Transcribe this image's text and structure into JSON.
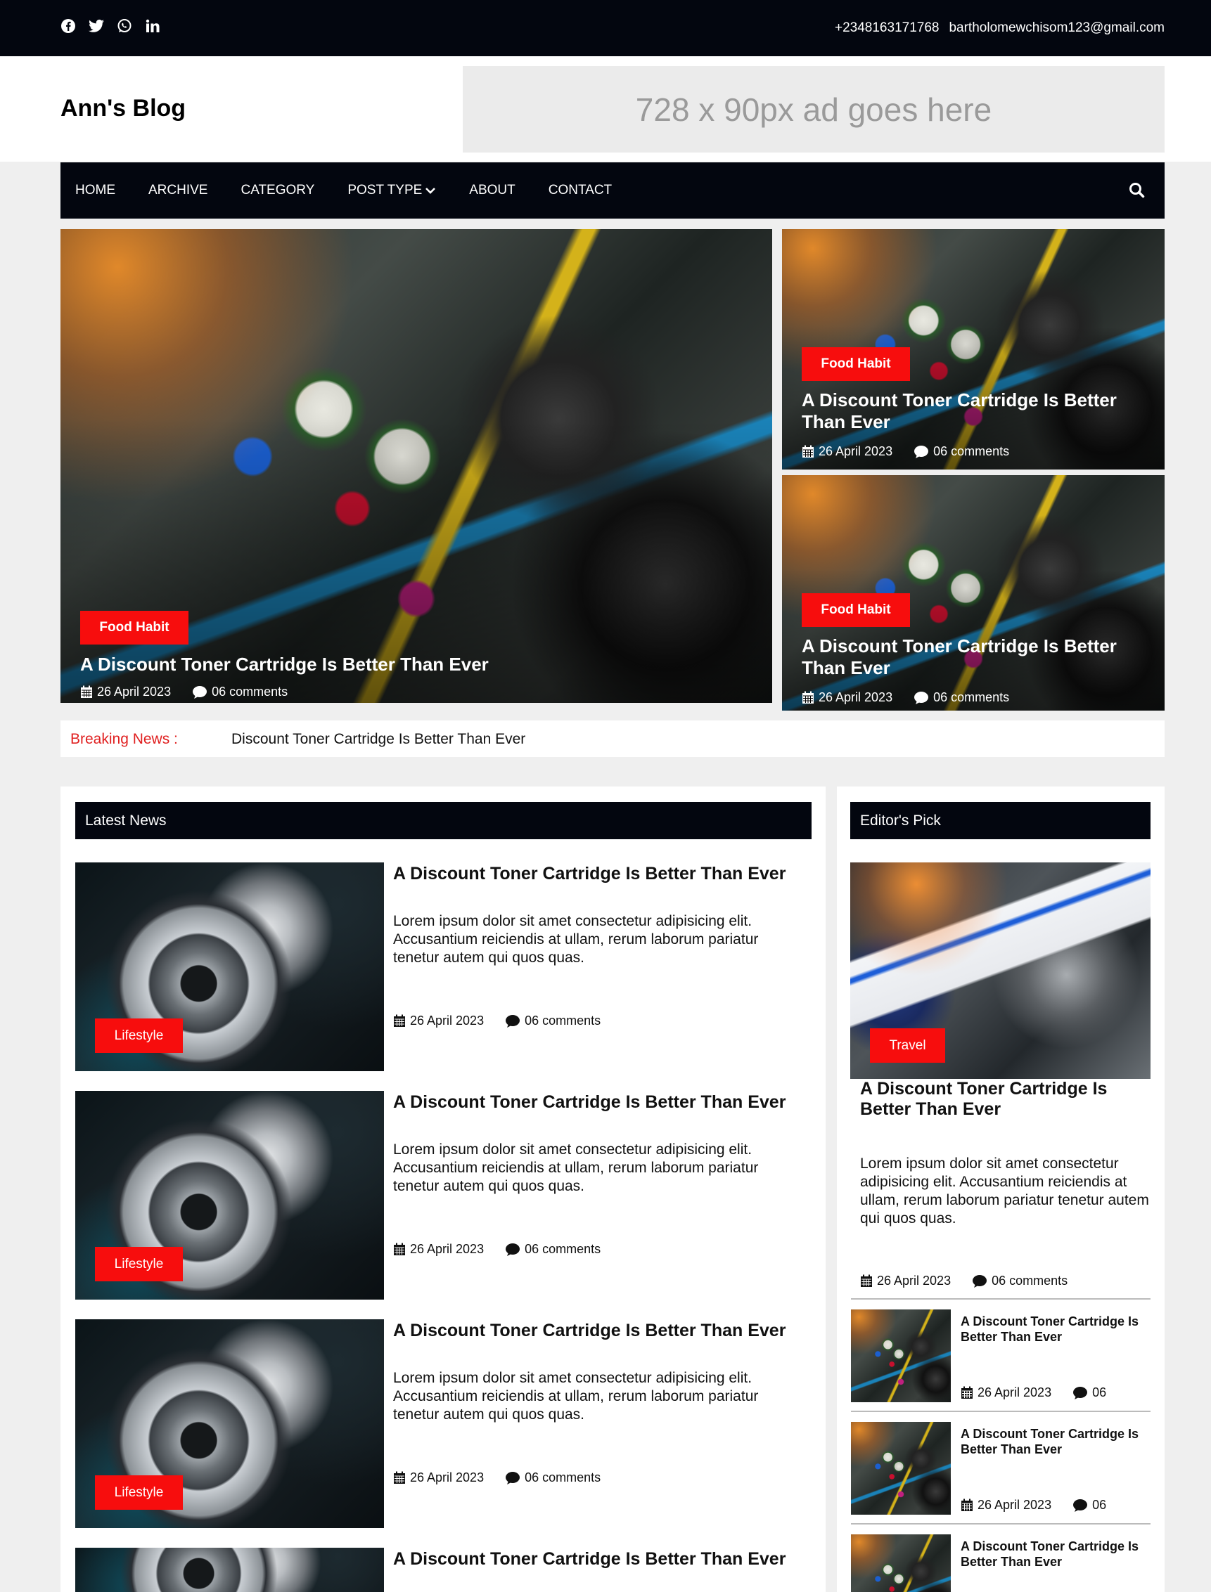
{
  "topbar": {
    "social_icons": [
      "facebook-icon",
      "twitter-icon",
      "whatsapp-icon",
      "linkedin-icon"
    ],
    "phone": "+2348163171768",
    "email": "bartholomewchisom123@gmail.com"
  },
  "header": {
    "logo": "Ann's Blog",
    "ad_text": "728 x 90px ad goes here"
  },
  "nav": {
    "items": [
      "HOME",
      "ARCHIVE",
      "CATEGORY",
      "POST TYPE",
      "ABOUT",
      "CONTACT"
    ],
    "search_icon": "search-icon"
  },
  "hero": {
    "main": {
      "tag": "Food Habit",
      "title": "A Discount Toner Cartridge Is Better Than Ever",
      "date": "26 April 2023",
      "comments": "06 comments"
    },
    "side": [
      {
        "tag": "Food Habit",
        "title": "A Discount Toner Cartridge Is Better Than Ever",
        "date": "26 April 2023",
        "comments": "06 comments"
      },
      {
        "tag": "Food Habit",
        "title": "A Discount Toner Cartridge Is Better Than Ever",
        "date": "26 April 2023",
        "comments": "06 comments"
      }
    ]
  },
  "breaking": {
    "label": "Breaking News :",
    "text": "Discount Toner Cartridge Is Better Than Ever"
  },
  "latest": {
    "heading": "Latest News",
    "items": [
      {
        "tag": "Lifestyle",
        "title": "A Discount Toner Cartridge Is Better Than Ever",
        "text": "Lorem ipsum dolor sit amet consectetur adipisicing elit. Accusantium reiciendis at ullam, rerum laborum pariatur tenetur autem qui quos quas.",
        "date": "26 April 2023",
        "comments": "06 comments"
      },
      {
        "tag": "Lifestyle",
        "title": "A Discount Toner Cartridge Is Better Than Ever",
        "text": "Lorem ipsum dolor sit amet consectetur adipisicing elit. Accusantium reiciendis at ullam, rerum laborum pariatur tenetur autem qui quos quas.",
        "date": "26 April 2023",
        "comments": "06 comments"
      },
      {
        "tag": "Lifestyle",
        "title": "A Discount Toner Cartridge Is Better Than Ever",
        "text": "Lorem ipsum dolor sit amet consectetur adipisicing elit. Accusantium reiciendis at ullam, rerum laborum pariatur tenetur autem qui quos quas.",
        "date": "26 April 2023",
        "comments": "06 comments"
      },
      {
        "title": "A Discount Toner Cartridge Is Better Than Ever"
      }
    ]
  },
  "editor": {
    "heading": "Editor's Pick",
    "featured": {
      "tag": "Travel",
      "title": "A Discount Toner Cartridge Is Better Than Ever",
      "text": "Lorem ipsum dolor sit amet consectetur adipisicing elit. Accusantium reiciendis at ullam, rerum laborum pariatur tenetur autem qui quos quas.",
      "date": "26 April 2023",
      "comments": "06 comments"
    },
    "small": [
      {
        "title": "A Discount Toner Cartridge Is Better Than Ever",
        "date": "26 April 2023",
        "comments": "06"
      },
      {
        "title": "A Discount Toner Cartridge Is Better Than Ever",
        "date": "26 April 2023",
        "comments": "06"
      },
      {
        "title": "A Discount Toner Cartridge Is Better Than Ever"
      }
    ]
  },
  "colors": {
    "dark": "#03060f",
    "accent_red": "#f70d0d",
    "breaking_red": "#e02020"
  }
}
